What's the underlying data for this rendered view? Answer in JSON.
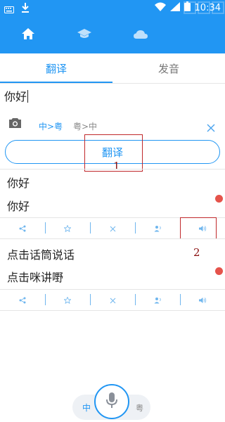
{
  "status_bar": {
    "time": "10:34"
  },
  "top_nav": {
    "items": [
      {
        "icon": "home-icon",
        "active": true
      },
      {
        "icon": "graduation-cap-icon",
        "active": false
      },
      {
        "icon": "cloud-icon",
        "active": false
      }
    ]
  },
  "tabs": [
    {
      "label": "翻译",
      "active": true
    },
    {
      "label": "发音",
      "active": false
    }
  ],
  "input": {
    "value": "你好"
  },
  "lang_options": {
    "zh_to_yue": "中>粤",
    "yue_to_zh": "粤>中",
    "selected": "中>粤"
  },
  "translate_button": {
    "label": "翻译"
  },
  "annotations": {
    "first": "1",
    "second": "2"
  },
  "results": [
    {
      "source": "你好",
      "target": "你好"
    },
    {
      "source": "点击话筒说话",
      "target": "点击咪讲嘢"
    }
  ],
  "action_icons": [
    "share-icon",
    "star-icon",
    "delete-icon",
    "speech-icon",
    "speaker-icon"
  ],
  "bottom_switch": {
    "left_label": "中",
    "right_label": "粤"
  },
  "colors": {
    "accent": "#2196f3",
    "annotation": "#c0282b",
    "dot": "#e5534b"
  }
}
